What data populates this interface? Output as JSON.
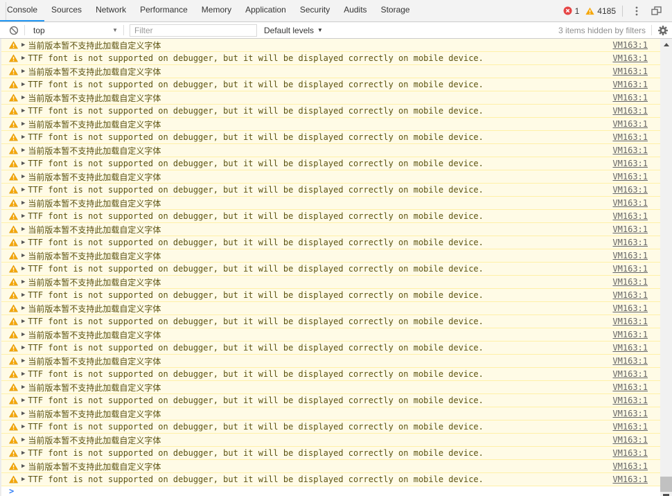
{
  "colors": {
    "accent_blue": "#2196f3",
    "toolbar_bg": "#f3f3f3",
    "warning_row_bg": "#fffbe6",
    "warning_row_border": "#fff0a7",
    "warning_text": "#5c5310",
    "error_badge_red": "#e64545",
    "warning_badge_amber": "#f5a70a",
    "link_gray": "#666666",
    "prompt_blue": "#2f7df6"
  },
  "tabs": {
    "items": [
      {
        "label": "Console",
        "active": true
      },
      {
        "label": "Sources",
        "active": false
      },
      {
        "label": "Network",
        "active": false
      },
      {
        "label": "Performance",
        "active": false
      },
      {
        "label": "Memory",
        "active": false
      },
      {
        "label": "Application",
        "active": false
      },
      {
        "label": "Security",
        "active": false
      },
      {
        "label": "Audits",
        "active": false
      },
      {
        "label": "Storage",
        "active": false
      }
    ]
  },
  "status": {
    "error_count": "1",
    "warning_count": "4185"
  },
  "console_toolbar": {
    "context": "top",
    "filter_placeholder": "Filter",
    "levels": "Default levels",
    "hidden_note": "3 items hidden by filters"
  },
  "glyphs": {
    "dropdown": "▼",
    "expand": "▶"
  },
  "console": {
    "prompt_symbol": ">",
    "messages": [
      {
        "text": "当前版本暂不支持此加载自定义字体",
        "link": "VM163:1"
      },
      {
        "text": "TTF font is not supported on debugger, but it will be displayed correctly on mobile device.",
        "link": "VM163:1"
      },
      {
        "text": "当前版本暂不支持此加载自定义字体",
        "link": "VM163:1"
      },
      {
        "text": "TTF font is not supported on debugger, but it will be displayed correctly on mobile device.",
        "link": "VM163:1"
      },
      {
        "text": "当前版本暂不支持此加载自定义字体",
        "link": "VM163:1"
      },
      {
        "text": "TTF font is not supported on debugger, but it will be displayed correctly on mobile device.",
        "link": "VM163:1"
      },
      {
        "text": "当前版本暂不支持此加载自定义字体",
        "link": "VM163:1"
      },
      {
        "text": "TTF font is not supported on debugger, but it will be displayed correctly on mobile device.",
        "link": "VM163:1"
      },
      {
        "text": "当前版本暂不支持此加载自定义字体",
        "link": "VM163:1"
      },
      {
        "text": "TTF font is not supported on debugger, but it will be displayed correctly on mobile device.",
        "link": "VM163:1"
      },
      {
        "text": "当前版本暂不支持此加载自定义字体",
        "link": "VM163:1"
      },
      {
        "text": "TTF font is not supported on debugger, but it will be displayed correctly on mobile device.",
        "link": "VM163:1"
      },
      {
        "text": "当前版本暂不支持此加载自定义字体",
        "link": "VM163:1"
      },
      {
        "text": "TTF font is not supported on debugger, but it will be displayed correctly on mobile device.",
        "link": "VM163:1"
      },
      {
        "text": "当前版本暂不支持此加载自定义字体",
        "link": "VM163:1"
      },
      {
        "text": "TTF font is not supported on debugger, but it will be displayed correctly on mobile device.",
        "link": "VM163:1"
      },
      {
        "text": "当前版本暂不支持此加载自定义字体",
        "link": "VM163:1"
      },
      {
        "text": "TTF font is not supported on debugger, but it will be displayed correctly on mobile device.",
        "link": "VM163:1"
      },
      {
        "text": "当前版本暂不支持此加载自定义字体",
        "link": "VM163:1"
      },
      {
        "text": "TTF font is not supported on debugger, but it will be displayed correctly on mobile device.",
        "link": "VM163:1"
      },
      {
        "text": "当前版本暂不支持此加载自定义字体",
        "link": "VM163:1"
      },
      {
        "text": "TTF font is not supported on debugger, but it will be displayed correctly on mobile device.",
        "link": "VM163:1"
      },
      {
        "text": "当前版本暂不支持此加载自定义字体",
        "link": "VM163:1"
      },
      {
        "text": "TTF font is not supported on debugger, but it will be displayed correctly on mobile device.",
        "link": "VM163:1"
      },
      {
        "text": "当前版本暂不支持此加载自定义字体",
        "link": "VM163:1"
      },
      {
        "text": "TTF font is not supported on debugger, but it will be displayed correctly on mobile device.",
        "link": "VM163:1"
      },
      {
        "text": "当前版本暂不支持此加载自定义字体",
        "link": "VM163:1"
      },
      {
        "text": "TTF font is not supported on debugger, but it will be displayed correctly on mobile device.",
        "link": "VM163:1"
      },
      {
        "text": "当前版本暂不支持此加载自定义字体",
        "link": "VM163:1"
      },
      {
        "text": "TTF font is not supported on debugger, but it will be displayed correctly on mobile device.",
        "link": "VM163:1"
      },
      {
        "text": "当前版本暂不支持此加载自定义字体",
        "link": "VM163:1"
      },
      {
        "text": "TTF font is not supported on debugger, but it will be displayed correctly on mobile device.",
        "link": "VM163:1"
      },
      {
        "text": "当前版本暂不支持此加载自定义字体",
        "link": "VM163:1"
      },
      {
        "text": "TTF font is not supported on debugger, but it will be displayed correctly on mobile device.",
        "link": "VM163:1"
      }
    ]
  }
}
